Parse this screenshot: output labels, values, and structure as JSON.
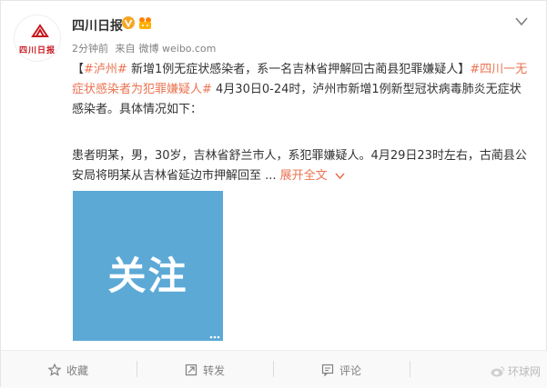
{
  "post": {
    "author": "四川日报",
    "avatar_text": "四川日报",
    "time": "2分钟前",
    "source_prefix": "来自",
    "source": "微博 weibo.com",
    "paragraph1": {
      "bracket_open": "【",
      "hashtag1": "#泸州#",
      "headline": " 新增1例无症状感染者，系一名吉林省押解回古蔺县犯罪嫌疑人】",
      "hashtag2": "#四川一无症状感染者为犯罪嫌疑人#",
      "body": " 4月30日0-24时，泸州市新增1例新型冠状病毒肺炎无症状感染者。具体情况如下："
    },
    "paragraph2": {
      "body": "患者明某，男，30岁，吉林省舒兰市人，系犯罪嫌疑人。4月29日23时左右，古蔺县公安局将明某从吉林省延边市押解回至 ...",
      "expand_link": "展开全文",
      "expand_icon": "chevron-down-icon"
    },
    "image": {
      "overlay_text": "关注"
    }
  },
  "actions": {
    "favorite": "收藏",
    "repost": "转发",
    "comment": "评论"
  },
  "watermark": "环球网",
  "colors": {
    "link": "#eb7350",
    "image_bg": "#5ca9d6",
    "brand_red": "#c8161d",
    "verified": "#f5a623"
  }
}
